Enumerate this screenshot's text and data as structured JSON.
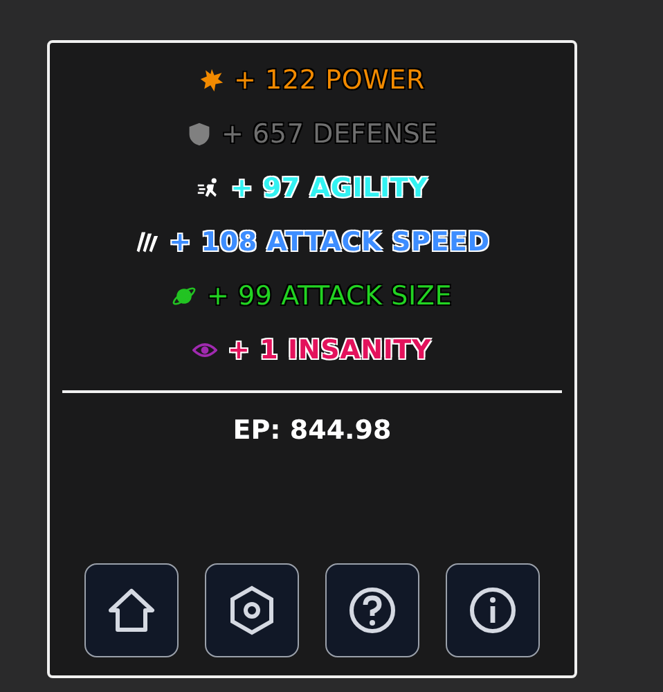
{
  "stats": [
    {
      "kind": "burst",
      "text": "+ 122 POWER",
      "color": "#f28a00",
      "bold": false
    },
    {
      "kind": "shield",
      "text": "+ 657 DEFENSE",
      "color": "#6f6f6f",
      "bold": false
    },
    {
      "kind": "runner",
      "text": "+ 97 AGILITY",
      "color": "#33f2f2",
      "bold": true
    },
    {
      "kind": "claws",
      "text": "+ 108 ATTACK SPEED",
      "color": "#3d8dff",
      "bold": true
    },
    {
      "kind": "planet",
      "text": "+ 99 ATTACK SIZE",
      "color": "#22d322",
      "bold": false
    },
    {
      "kind": "eye",
      "text": "+ 1 INSANITY",
      "color": "#e3125c",
      "bold": true
    }
  ],
  "ep": "EP: 844.98",
  "buttons": [
    {
      "kind": "home"
    },
    {
      "kind": "settings"
    },
    {
      "kind": "help"
    },
    {
      "kind": "info"
    }
  ]
}
